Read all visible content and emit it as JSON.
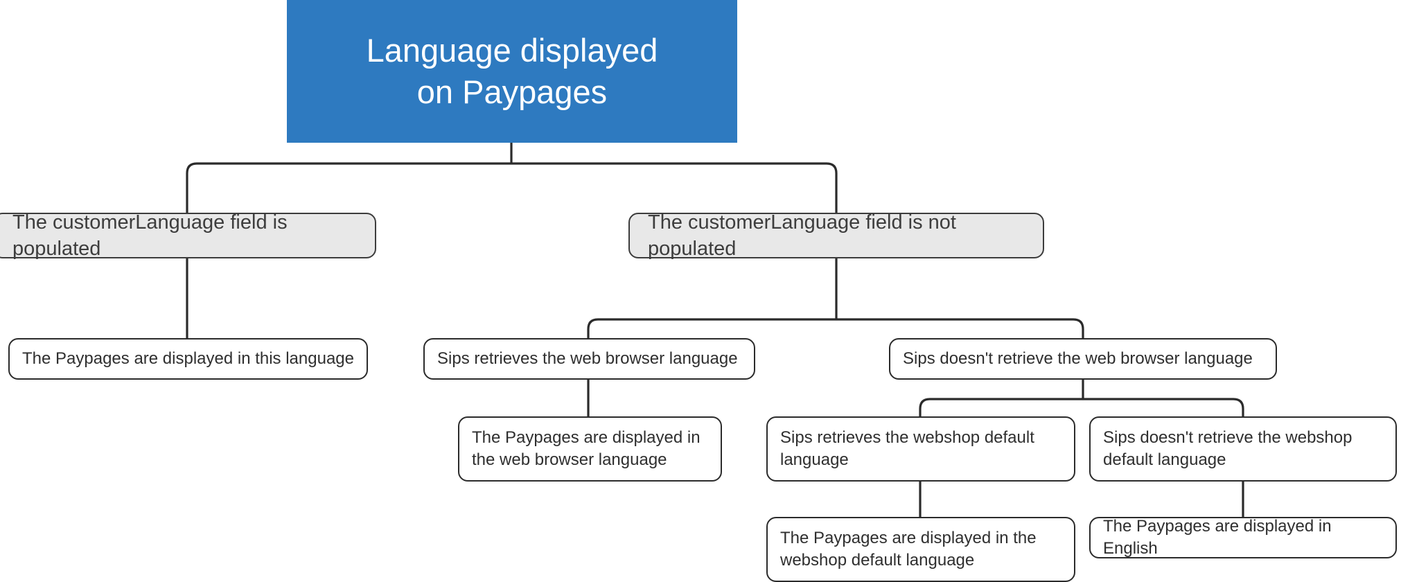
{
  "diagram": {
    "title": "Language displayed on Paypages",
    "type": "decision-tree",
    "colors": {
      "root_fill": "#2e7ac0",
      "root_text": "#ffffff",
      "level2_fill": "#e8e8e8",
      "level2_border": "#3c3c3c",
      "leaf_fill": "#ffffff",
      "leaf_border": "#2b2b2b",
      "body_text": "#3d3d3d",
      "edge": "#2b2b2b",
      "background": "#ffffff"
    },
    "nodes": {
      "root": "Language displayed\non Paypages",
      "customer_language_populated": "The customerLanguage field is\npopulated",
      "customer_language_not_populated": "The customerLanguage field is not\npopulated",
      "displayed_this_language": "The Paypages are displayed in this language",
      "sips_retrieves_browser": "Sips retrieves the web browser language",
      "sips_not_retrieves_browser": "Sips doesn't retrieve the web browser language",
      "displayed_browser_language": "The Paypages are displayed in\nthe web browser language",
      "sips_retrieves_webshop_default": "Sips retrieves the webshop default\nlanguage",
      "sips_not_retrieves_webshop_default": "Sips doesn't retrieve the webshop\ndefault language",
      "displayed_webshop_default": "The Paypages are displayed in the\nwebshop default language",
      "displayed_english": "The Paypages are displayed in English"
    },
    "edges": [
      {
        "from": "root",
        "to": "customer_language_populated"
      },
      {
        "from": "root",
        "to": "customer_language_not_populated"
      },
      {
        "from": "customer_language_populated",
        "to": "displayed_this_language"
      },
      {
        "from": "customer_language_not_populated",
        "to": "sips_retrieves_browser"
      },
      {
        "from": "customer_language_not_populated",
        "to": "sips_not_retrieves_browser"
      },
      {
        "from": "sips_retrieves_browser",
        "to": "displayed_browser_language"
      },
      {
        "from": "sips_not_retrieves_browser",
        "to": "sips_retrieves_webshop_default"
      },
      {
        "from": "sips_not_retrieves_browser",
        "to": "sips_not_retrieves_webshop_default"
      },
      {
        "from": "sips_retrieves_webshop_default",
        "to": "displayed_webshop_default"
      },
      {
        "from": "sips_not_retrieves_webshop_default",
        "to": "displayed_english"
      }
    ]
  }
}
